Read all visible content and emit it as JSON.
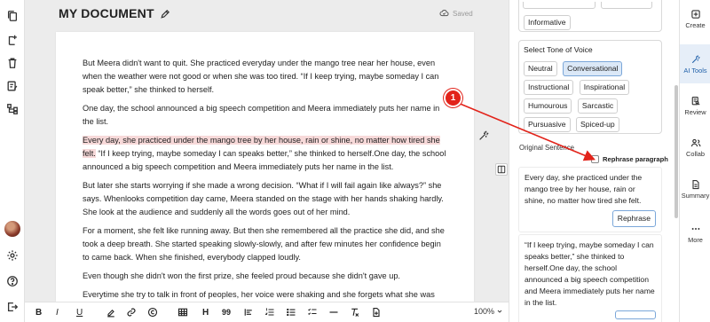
{
  "document": {
    "title": "MY DOCUMENT",
    "saved_label": "Saved",
    "paragraphs": [
      "But Meera didn't want to quit. She practiced everyday under the mango tree near her house, even when the weather were not good or when she was too tired. “If I keep trying, maybe someday I can speak better,” she thinked to herself.",
      "One day, the school announced a big speech competition and Meera immediately puts her name in the list.",
      "But later she starts worrying if she made a wrong decision. “What if I will fail again like always?” she says. Whenlooks competition day came, Meera standed on the stage with her hands shaking hardly. She look at the audience and suddenly all the words goes out of her mind.",
      "For a moment, she felt like running away. But then she remembered all the practice she did, and she took a deep breath. She started speaking slowly-slowly, and after few minutes her confidence begin to came back. When she finished, everybody clapped loudly.",
      "Even though she didn't won the first prize, she feeled proud because she didn't gave up.",
      "Everytime she try to talk in front of peoples, her voice were shaking and she forgets what she was suppose to say. Many of her classmates was laughing on her, telling she will never be good in anything."
    ],
    "highlighted_paragraph": {
      "highlight": "Every day, she practiced under the mango tree by her house, rain or shine, no matter how tired she felt.",
      "rest": " “If I keep trying, maybe someday I can speaks better,” she thinked to herself.One day, the school announced a big speech competition and Meera immediately puts her name in the list."
    }
  },
  "annotation": {
    "marker_number": "1",
    "color": "#e2231a"
  },
  "toolbar": {
    "bold": "B",
    "italic": "I",
    "underline": "U",
    "heading": "H",
    "quote": "99",
    "zoom": "100%"
  },
  "panel": {
    "top_chips": [
      "Informative"
    ],
    "tone": {
      "title": "Select Tone of Voice",
      "chips": [
        "Neutral",
        "Conversational",
        "Instructional",
        "Inspirational",
        "Humourous",
        "Sarcastic",
        "Pursuasive",
        "Spiced-up"
      ],
      "active": "Conversational"
    },
    "original_sentence_label": "Original Sentence",
    "rephrase_paragraph_label": "Rephrase paragraph",
    "sentences": [
      "Every day, she practiced under the mango tree by her house, rain or shine, no matter how tired she felt.",
      "“If I keep trying, maybe someday I can speaks better,” she thinked to herself.One day, the school announced a big speech competition and Meera immediately puts her name in the list."
    ],
    "rephrase_button": "Rephrase"
  },
  "right_rail": {
    "items": [
      "Create",
      "AI Tools",
      "Review",
      "Collab",
      "Summary",
      "More"
    ],
    "active": "AI Tools"
  }
}
